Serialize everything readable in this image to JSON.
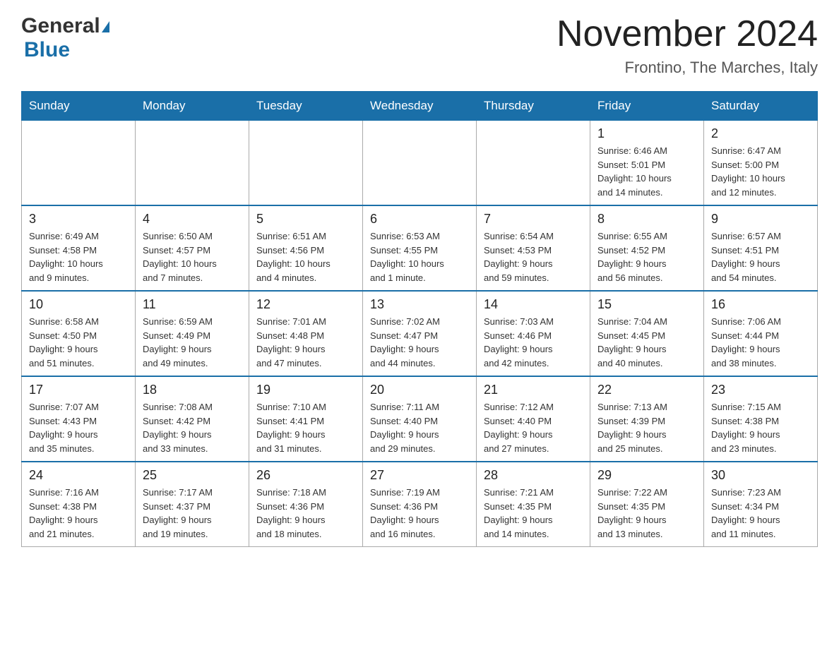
{
  "header": {
    "logo_general": "General",
    "logo_blue": "Blue",
    "month_title": "November 2024",
    "location": "Frontino, The Marches, Italy"
  },
  "weekdays": [
    "Sunday",
    "Monday",
    "Tuesday",
    "Wednesday",
    "Thursday",
    "Friday",
    "Saturday"
  ],
  "weeks": [
    [
      {
        "day": "",
        "info": ""
      },
      {
        "day": "",
        "info": ""
      },
      {
        "day": "",
        "info": ""
      },
      {
        "day": "",
        "info": ""
      },
      {
        "day": "",
        "info": ""
      },
      {
        "day": "1",
        "info": "Sunrise: 6:46 AM\nSunset: 5:01 PM\nDaylight: 10 hours\nand 14 minutes."
      },
      {
        "day": "2",
        "info": "Sunrise: 6:47 AM\nSunset: 5:00 PM\nDaylight: 10 hours\nand 12 minutes."
      }
    ],
    [
      {
        "day": "3",
        "info": "Sunrise: 6:49 AM\nSunset: 4:58 PM\nDaylight: 10 hours\nand 9 minutes."
      },
      {
        "day": "4",
        "info": "Sunrise: 6:50 AM\nSunset: 4:57 PM\nDaylight: 10 hours\nand 7 minutes."
      },
      {
        "day": "5",
        "info": "Sunrise: 6:51 AM\nSunset: 4:56 PM\nDaylight: 10 hours\nand 4 minutes."
      },
      {
        "day": "6",
        "info": "Sunrise: 6:53 AM\nSunset: 4:55 PM\nDaylight: 10 hours\nand 1 minute."
      },
      {
        "day": "7",
        "info": "Sunrise: 6:54 AM\nSunset: 4:53 PM\nDaylight: 9 hours\nand 59 minutes."
      },
      {
        "day": "8",
        "info": "Sunrise: 6:55 AM\nSunset: 4:52 PM\nDaylight: 9 hours\nand 56 minutes."
      },
      {
        "day": "9",
        "info": "Sunrise: 6:57 AM\nSunset: 4:51 PM\nDaylight: 9 hours\nand 54 minutes."
      }
    ],
    [
      {
        "day": "10",
        "info": "Sunrise: 6:58 AM\nSunset: 4:50 PM\nDaylight: 9 hours\nand 51 minutes."
      },
      {
        "day": "11",
        "info": "Sunrise: 6:59 AM\nSunset: 4:49 PM\nDaylight: 9 hours\nand 49 minutes."
      },
      {
        "day": "12",
        "info": "Sunrise: 7:01 AM\nSunset: 4:48 PM\nDaylight: 9 hours\nand 47 minutes."
      },
      {
        "day": "13",
        "info": "Sunrise: 7:02 AM\nSunset: 4:47 PM\nDaylight: 9 hours\nand 44 minutes."
      },
      {
        "day": "14",
        "info": "Sunrise: 7:03 AM\nSunset: 4:46 PM\nDaylight: 9 hours\nand 42 minutes."
      },
      {
        "day": "15",
        "info": "Sunrise: 7:04 AM\nSunset: 4:45 PM\nDaylight: 9 hours\nand 40 minutes."
      },
      {
        "day": "16",
        "info": "Sunrise: 7:06 AM\nSunset: 4:44 PM\nDaylight: 9 hours\nand 38 minutes."
      }
    ],
    [
      {
        "day": "17",
        "info": "Sunrise: 7:07 AM\nSunset: 4:43 PM\nDaylight: 9 hours\nand 35 minutes."
      },
      {
        "day": "18",
        "info": "Sunrise: 7:08 AM\nSunset: 4:42 PM\nDaylight: 9 hours\nand 33 minutes."
      },
      {
        "day": "19",
        "info": "Sunrise: 7:10 AM\nSunset: 4:41 PM\nDaylight: 9 hours\nand 31 minutes."
      },
      {
        "day": "20",
        "info": "Sunrise: 7:11 AM\nSunset: 4:40 PM\nDaylight: 9 hours\nand 29 minutes."
      },
      {
        "day": "21",
        "info": "Sunrise: 7:12 AM\nSunset: 4:40 PM\nDaylight: 9 hours\nand 27 minutes."
      },
      {
        "day": "22",
        "info": "Sunrise: 7:13 AM\nSunset: 4:39 PM\nDaylight: 9 hours\nand 25 minutes."
      },
      {
        "day": "23",
        "info": "Sunrise: 7:15 AM\nSunset: 4:38 PM\nDaylight: 9 hours\nand 23 minutes."
      }
    ],
    [
      {
        "day": "24",
        "info": "Sunrise: 7:16 AM\nSunset: 4:38 PM\nDaylight: 9 hours\nand 21 minutes."
      },
      {
        "day": "25",
        "info": "Sunrise: 7:17 AM\nSunset: 4:37 PM\nDaylight: 9 hours\nand 19 minutes."
      },
      {
        "day": "26",
        "info": "Sunrise: 7:18 AM\nSunset: 4:36 PM\nDaylight: 9 hours\nand 18 minutes."
      },
      {
        "day": "27",
        "info": "Sunrise: 7:19 AM\nSunset: 4:36 PM\nDaylight: 9 hours\nand 16 minutes."
      },
      {
        "day": "28",
        "info": "Sunrise: 7:21 AM\nSunset: 4:35 PM\nDaylight: 9 hours\nand 14 minutes."
      },
      {
        "day": "29",
        "info": "Sunrise: 7:22 AM\nSunset: 4:35 PM\nDaylight: 9 hours\nand 13 minutes."
      },
      {
        "day": "30",
        "info": "Sunrise: 7:23 AM\nSunset: 4:34 PM\nDaylight: 9 hours\nand 11 minutes."
      }
    ]
  ]
}
